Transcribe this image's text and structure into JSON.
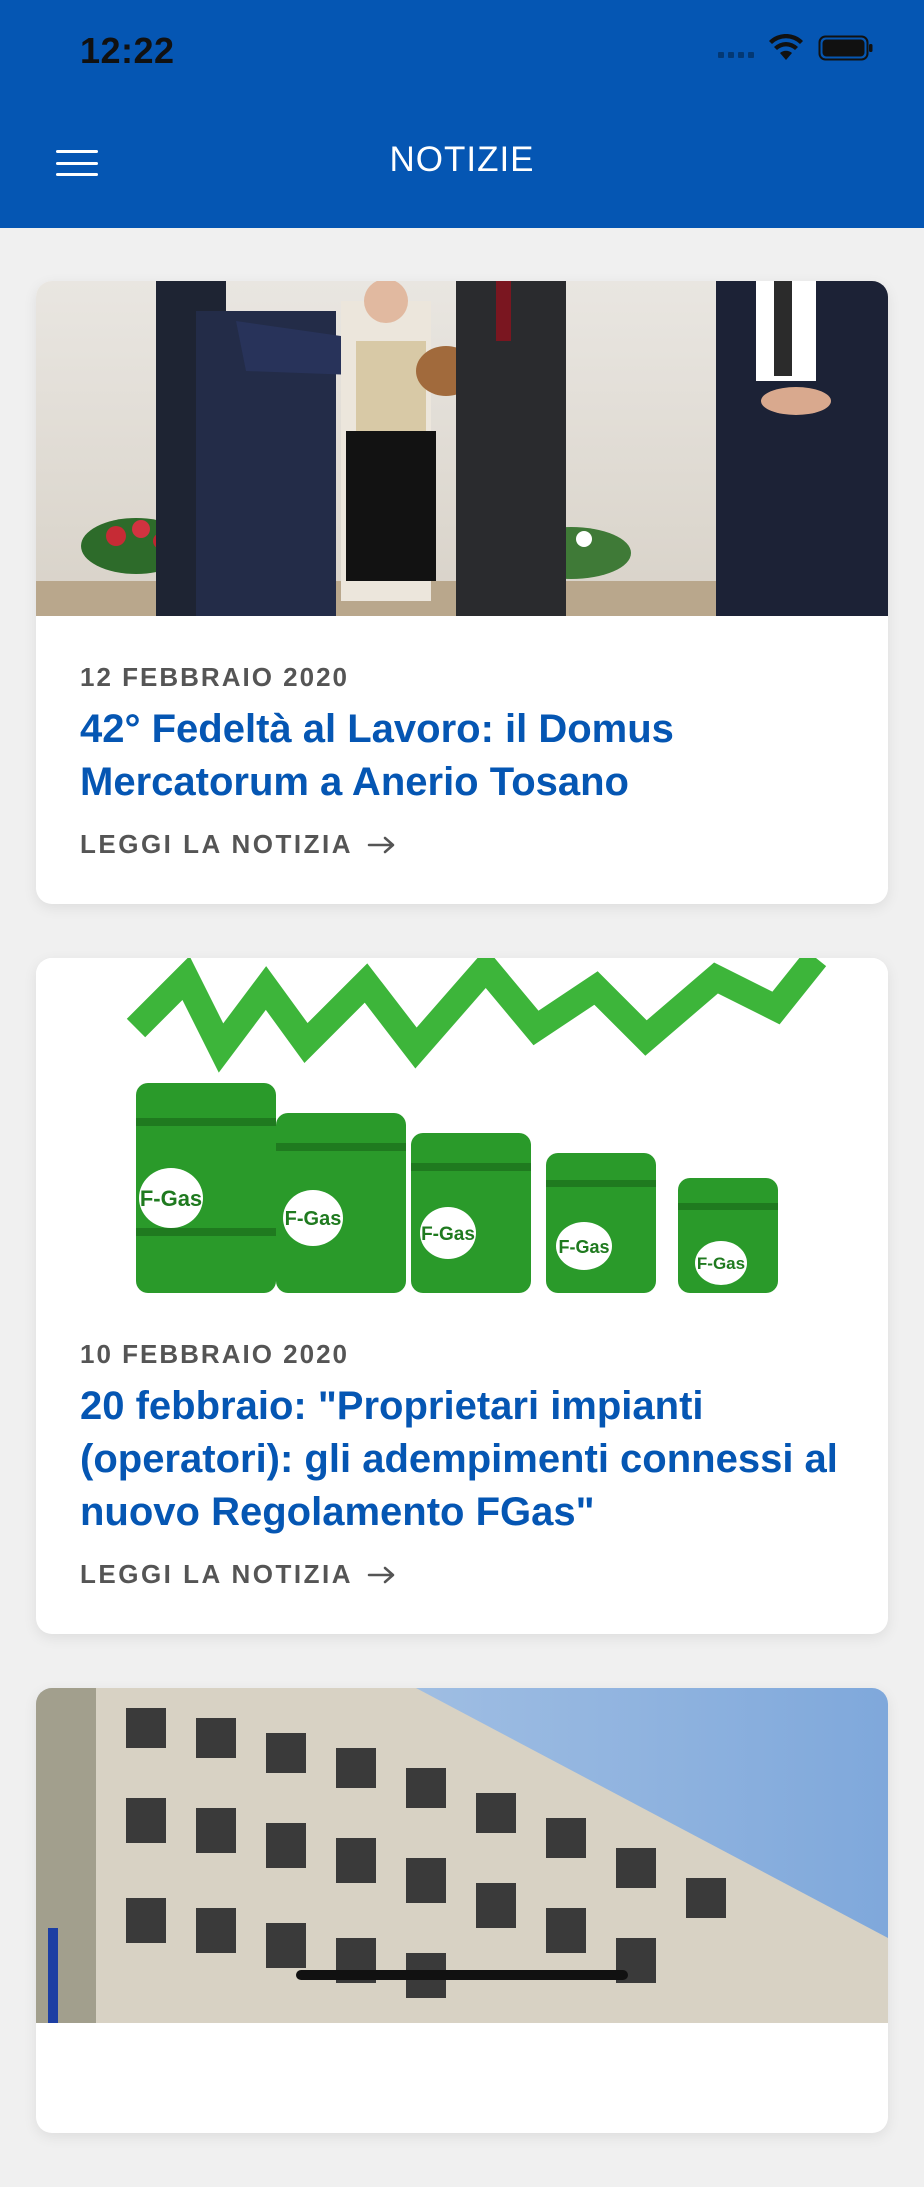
{
  "status_bar": {
    "time": "12:22"
  },
  "header": {
    "title": "NOTIZIE"
  },
  "news": [
    {
      "date": "12 FEBBRAIO 2020",
      "title": "42° Fedeltà al Lavoro: il Domus Mercatorum a Anerio Tosano",
      "link_label": "LEGGI LA NOTIZIA"
    },
    {
      "date": "10 FEBBRAIO 2020",
      "title": "20 febbraio: \"Proprietari impianti (operatori): gli adempimenti connessi al nuovo Regolamento FGas\"",
      "link_label": "LEGGI LA NOTIZIA",
      "barrel_label": "F-Gas"
    },
    {
      "date": "",
      "title": "",
      "link_label": ""
    }
  ],
  "colors": {
    "brand": "#0556b3",
    "title_blue": "#0556b3",
    "meta_gray": "#555555",
    "barrel_green": "#2a9a2a"
  },
  "icons": [
    "hamburger-menu-icon",
    "wifi-icon",
    "battery-icon",
    "signal-icon",
    "arrow-right-icon"
  ]
}
